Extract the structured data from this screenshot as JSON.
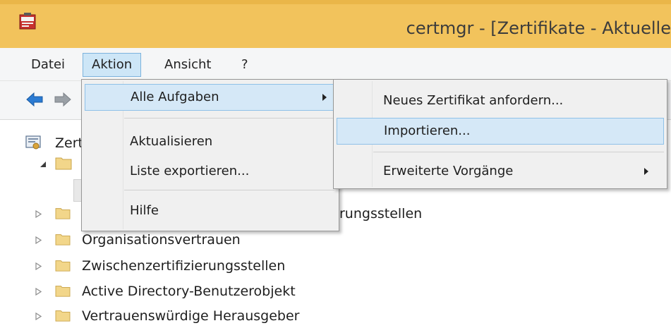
{
  "window": {
    "title": "certmgr - [Zertifikate - Aktuelle"
  },
  "menubar": {
    "items": [
      {
        "label": "Datei"
      },
      {
        "label": "Aktion"
      },
      {
        "label": "Ansicht"
      },
      {
        "label": "?"
      }
    ]
  },
  "toolbar": {
    "icons": [
      "back-arrow-icon",
      "forward-arrow-icon"
    ]
  },
  "tree": {
    "root_label": "Zert",
    "items": [
      {
        "label": "rungsstellen"
      },
      {
        "label": "Organisationsvertrauen"
      },
      {
        "label": "Zwischenzertifizierungsstellen"
      },
      {
        "label": "Active Directory-Benutzerobjekt"
      },
      {
        "label": "Vertrauenswürdige Herausgeber"
      }
    ]
  },
  "aktion_menu": {
    "items": [
      {
        "label": "Alle Aufgaben"
      },
      {
        "label": "Aktualisieren"
      },
      {
        "label": "Liste exportieren..."
      },
      {
        "label": "Hilfe"
      }
    ]
  },
  "alle_aufgaben_submenu": {
    "items": [
      {
        "label": "Neues Zertifikat anfordern..."
      },
      {
        "label": "Importieren..."
      },
      {
        "label": "Erweiterte Vorgänge"
      }
    ]
  },
  "colors": {
    "title_bar": "#f2c35c",
    "menu_highlight": "#d5e8f7",
    "menu_highlight_border": "#8fc1e8"
  }
}
